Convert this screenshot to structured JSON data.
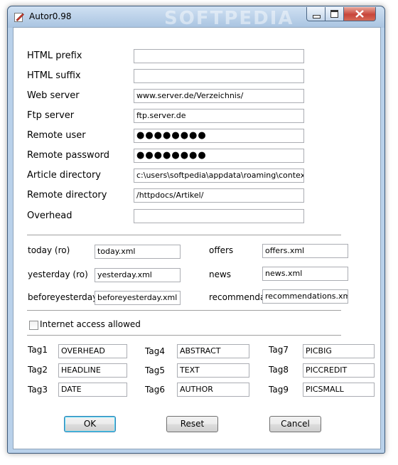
{
  "window": {
    "title": "Autor0.98",
    "watermark": "SOFTPEDIA"
  },
  "fields": [
    {
      "label": "HTML prefix",
      "value": ""
    },
    {
      "label": "HTML suffix",
      "value": ""
    },
    {
      "label": "Web server",
      "value": "www.server.de/Verzeichnis/"
    },
    {
      "label": "Ftp server",
      "value": "ftp.server.de"
    },
    {
      "label": "Remote user",
      "value": "●●●●●●●●"
    },
    {
      "label": "Remote password",
      "value": "●●●●●●●●"
    },
    {
      "label": "Article directory",
      "value": "c:\\users\\softpedia\\appdata\\roaming\\context it gi"
    },
    {
      "label": "Remote directory",
      "value": "/httpdocs/Artikel/"
    },
    {
      "label": "Overhead",
      "value": ""
    }
  ],
  "files": [
    {
      "label": "today (ro)",
      "value": "today.xml"
    },
    {
      "label": "offers",
      "value": "offers.xml"
    },
    {
      "label": "yesterday (ro)",
      "value": "yesterday.xml"
    },
    {
      "label": "news",
      "value": "news.xml"
    },
    {
      "label": "beforeyesterday (ro)",
      "value": "beforeyesterday.xml"
    },
    {
      "label": "recommendations",
      "value": "recommendations.xml"
    }
  ],
  "internet_access": {
    "label": "Internet access allowed",
    "checked": false
  },
  "tags": [
    {
      "label": "Tag1",
      "value": "OVERHEAD"
    },
    {
      "label": "Tag2",
      "value": "HEADLINE"
    },
    {
      "label": "Tag3",
      "value": "DATE"
    },
    {
      "label": "Tag4",
      "value": "ABSTRACT"
    },
    {
      "label": "Tag5",
      "value": "TEXT"
    },
    {
      "label": "Tag6",
      "value": "AUTHOR"
    },
    {
      "label": "Tag7",
      "value": "PICBIG"
    },
    {
      "label": "Tag8",
      "value": "PICCREDIT"
    },
    {
      "label": "Tag9",
      "value": "PICSMALL"
    }
  ],
  "buttons": {
    "ok": "OK",
    "reset": "Reset",
    "cancel": "Cancel"
  },
  "icons": {
    "app": "pencil-icon",
    "minimize": "minimize-icon",
    "maximize": "maximize-icon",
    "close": "close-icon"
  }
}
